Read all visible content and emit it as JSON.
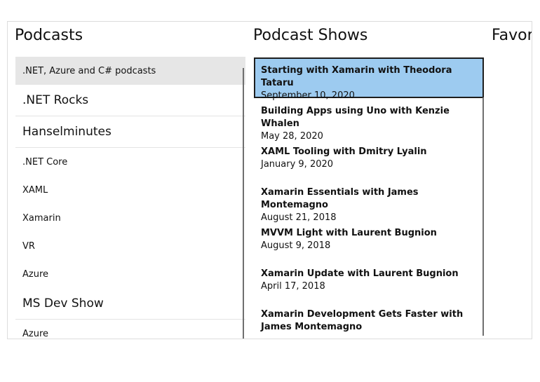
{
  "columns": {
    "podcasts": "Podcasts",
    "shows": "Podcast Shows",
    "favorites": "Favor"
  },
  "podcasts": [
    {
      "kind": "hdr",
      "label": ".NET, Azure and C# podcasts"
    },
    {
      "kind": "group",
      "label": ".NET Rocks"
    },
    {
      "kind": "group",
      "label": "Hanselminutes"
    },
    {
      "kind": "item",
      "label": ".NET Core"
    },
    {
      "kind": "item",
      "label": "XAML"
    },
    {
      "kind": "item",
      "label": "Xamarin"
    },
    {
      "kind": "item",
      "label": "VR"
    },
    {
      "kind": "item",
      "label": "Azure"
    },
    {
      "kind": "group",
      "label": "MS Dev Show"
    },
    {
      "kind": "item",
      "label": "Azure"
    }
  ],
  "shows": [
    {
      "title": "Starting with Xamarin with Theodora Tataru",
      "date": "September 10, 2020",
      "selected": true
    },
    {
      "title": "Building Apps using Uno with Kenzie Whalen",
      "date": "May 28, 2020"
    },
    {
      "title": "XAML Tooling with Dmitry Lyalin",
      "date": "January 9, 2020"
    },
    {
      "title": "Xamarin Essentials with James Montemagno",
      "date": "August 21, 2018"
    },
    {
      "title": "MVVM Light with Laurent Bugnion",
      "date": "August 9, 2018"
    },
    {
      "title": "Xamarin Update with Laurent Bugnion",
      "date": "April 17, 2018"
    },
    {
      "title": "Xamarin Development Gets Faster with James Montemagno",
      "date": ""
    }
  ],
  "colors": {
    "selection": "#9dcbf0",
    "header_bg": "#e6e6e6"
  }
}
